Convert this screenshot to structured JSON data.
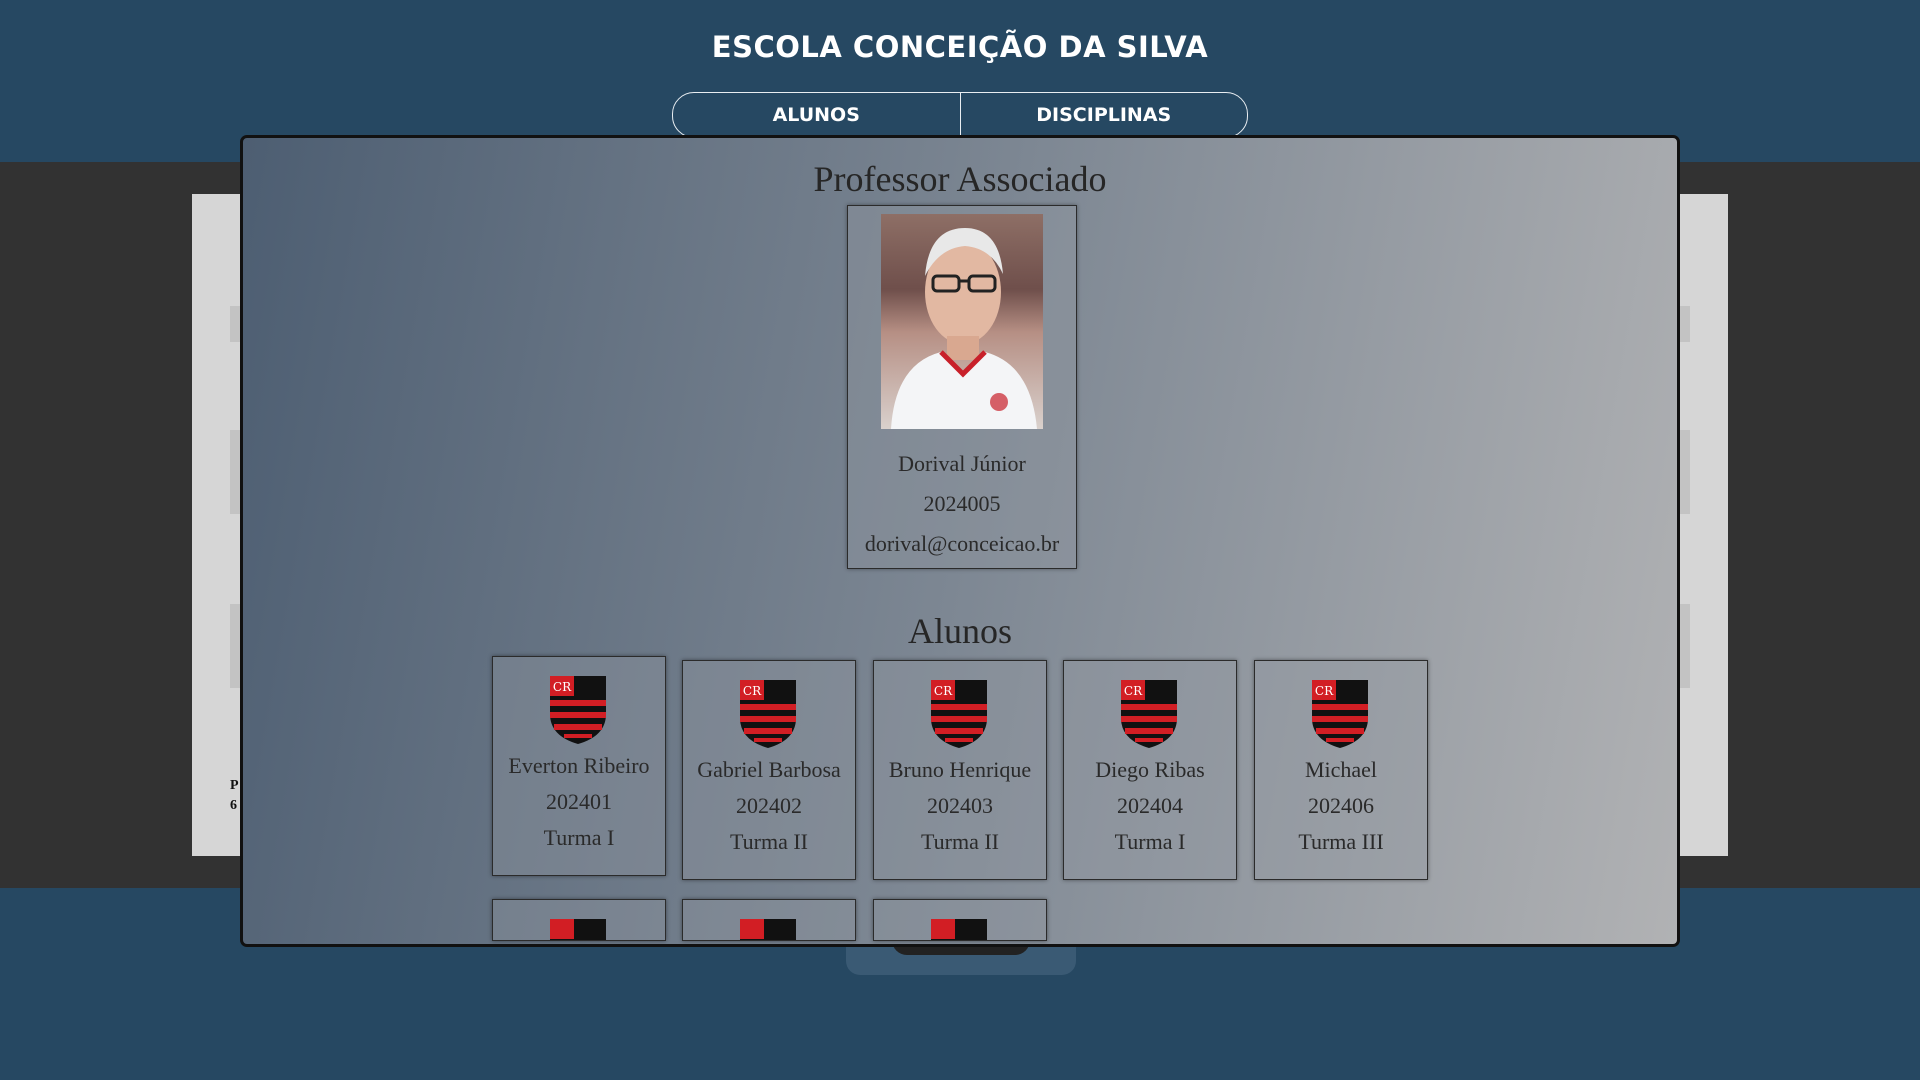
{
  "site": {
    "title": "ESCOLA CONCEIÇÃO DA SILVA"
  },
  "nav": {
    "items": [
      {
        "label": "ALUNOS"
      },
      {
        "label": "DISCIPLINAS"
      }
    ]
  },
  "background": {
    "texts": [
      "P",
      "6"
    ]
  },
  "modal": {
    "professor_title": "Professor Associado",
    "professor": {
      "name": "Dorival Júnior",
      "id": "2024005",
      "email": "dorival@conceicao.br"
    },
    "students_title": "Alunos",
    "students": [
      {
        "name": "Everton Ribeiro",
        "id": "202401",
        "class": "Turma I"
      },
      {
        "name": "Gabriel Barbosa",
        "id": "202402",
        "class": "Turma II"
      },
      {
        "name": "Bruno Henrique",
        "id": "202403",
        "class": "Turma II"
      },
      {
        "name": "Diego Ribas",
        "id": "202404",
        "class": "Turma I"
      },
      {
        "name": "Michael",
        "id": "202406",
        "class": "Turma III"
      }
    ]
  },
  "colors": {
    "header": "#264862",
    "crest_red": "#d21e24",
    "crest_black": "#111111"
  }
}
